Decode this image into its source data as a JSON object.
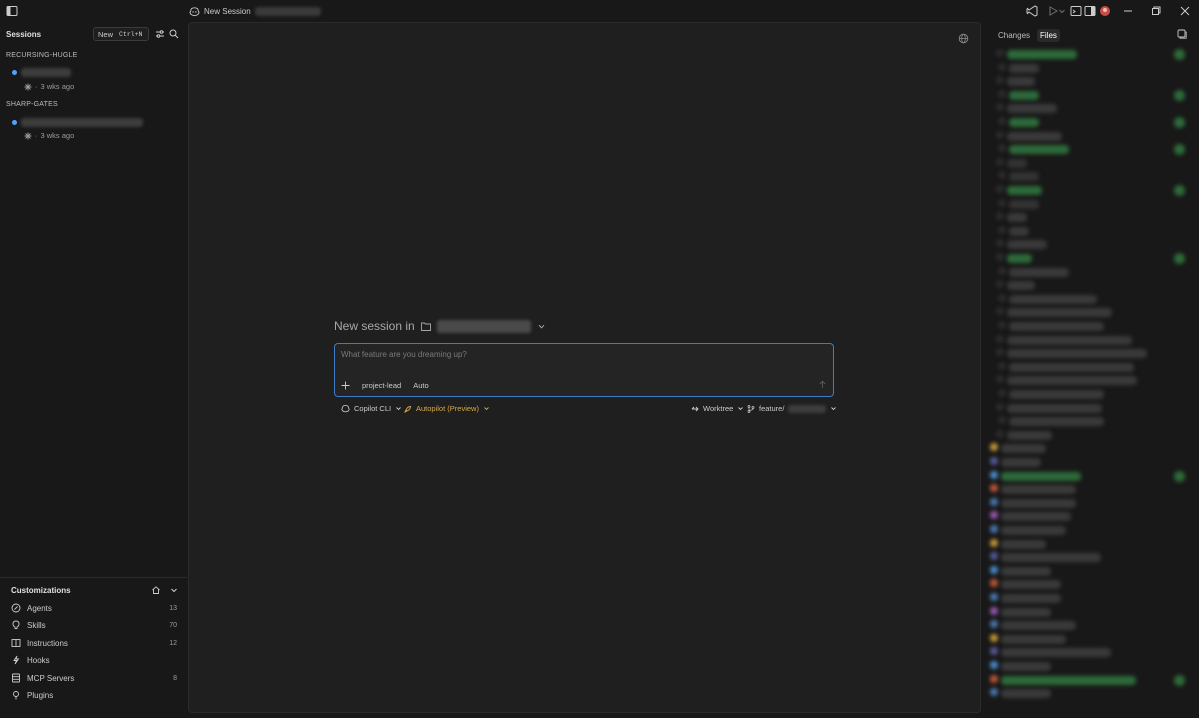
{
  "titlebar": {
    "title": "New Session",
    "icons": [
      "sidebar-toggle-icon",
      "vscode-icon",
      "run-icon",
      "chevron-down-icon",
      "terminal-icon",
      "layout-icon",
      "account-icon",
      "minimize-icon",
      "restore-icon",
      "close-icon"
    ]
  },
  "sidebar": {
    "sessions_label": "Sessions",
    "new_label": "New",
    "new_shortcut": "Ctrl+N",
    "groups": [
      {
        "label": "RECURSING-HUGLE",
        "sessions": [
          {
            "time": "3 wks ago"
          }
        ]
      },
      {
        "label": "SHARP-GATES",
        "sessions": [
          {
            "time": "3 wks ago"
          }
        ]
      }
    ]
  },
  "customizations": {
    "title": "Customizations",
    "items": [
      {
        "label": "Agents",
        "count": "13",
        "icon": "agents-icon"
      },
      {
        "label": "Skills",
        "count": "70",
        "icon": "skills-icon"
      },
      {
        "label": "Instructions",
        "count": "12",
        "icon": "book-icon"
      },
      {
        "label": "Hooks",
        "count": "",
        "icon": "hooks-icon"
      },
      {
        "label": "MCP Servers",
        "count": "8",
        "icon": "server-icon"
      },
      {
        "label": "Plugins",
        "count": "",
        "icon": "plugin-icon"
      }
    ]
  },
  "main": {
    "new_session_in": "New session in",
    "prompt_placeholder": "What feature are you dreaming up?",
    "agent_label": "project-lead",
    "model_label": "Auto",
    "backend_label": "Copilot CLI",
    "mode_label": "Autopilot (Preview)",
    "worktree_label": "Worktree",
    "branch_prefix": "feature/"
  },
  "rightpanel": {
    "tabs": [
      "Changes",
      "Files"
    ],
    "active_tab": "Files"
  },
  "colors": {
    "accent_blue": "#4fa3ff",
    "autopilot_yellow": "#d7a94a",
    "focus_border": "#3e7cc8",
    "added_green": "#2fa64a"
  }
}
